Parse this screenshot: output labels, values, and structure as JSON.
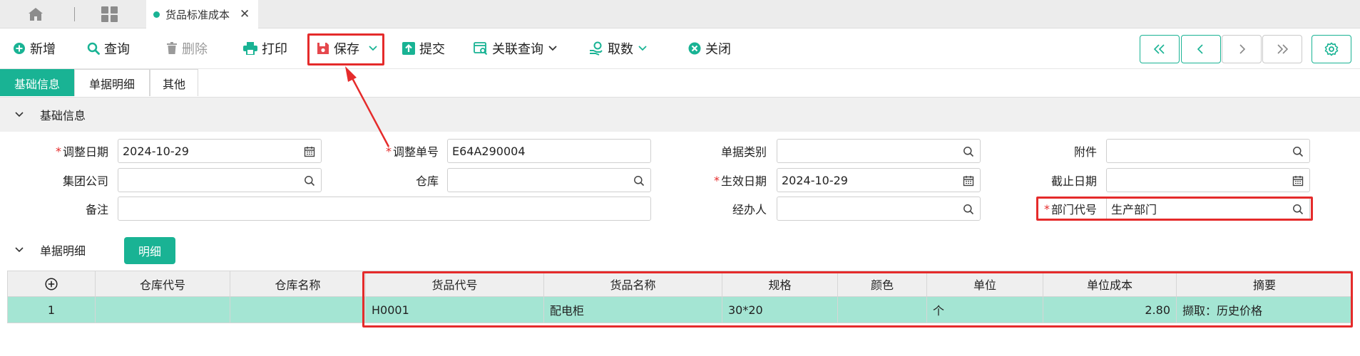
{
  "tabbar": {
    "active_tab_label": "货品标准成本",
    "close_glyph": "✕"
  },
  "toolbar": {
    "add": "新增",
    "query": "查询",
    "delete": "删除",
    "print": "打印",
    "save": "保存",
    "submit": "提交",
    "related_query": "关联查询",
    "fetch": "取数",
    "close": "关闭"
  },
  "subtabs": [
    "基础信息",
    "单据明细",
    "其他"
  ],
  "basic_section": {
    "title": "基础信息"
  },
  "form": {
    "adjust_date": {
      "label": "调整日期",
      "value": "2024-10-29",
      "required": true
    },
    "adjust_no": {
      "label": "调整单号",
      "value": "E64A290004",
      "required": true
    },
    "doc_type": {
      "label": "单据类别",
      "value": ""
    },
    "attachment": {
      "label": "附件",
      "value": ""
    },
    "group_company": {
      "label": "集团公司",
      "value": ""
    },
    "warehouse": {
      "label": "仓库",
      "value": ""
    },
    "effective_date": {
      "label": "生效日期",
      "value": "2024-10-29",
      "required": true
    },
    "end_date": {
      "label": "截止日期",
      "value": ""
    },
    "remark": {
      "label": "备注",
      "value": ""
    },
    "handler": {
      "label": "经办人",
      "value": ""
    },
    "dept_code": {
      "label": "部门代号",
      "value": "生产部门",
      "required": true
    },
    "required_mark": "*"
  },
  "detail_section": {
    "title": "单据明细",
    "button": "明细"
  },
  "table": {
    "headers": [
      "⊕",
      "仓库代号",
      "仓库名称",
      "货品代号",
      "货品名称",
      "规格",
      "颜色",
      "单位",
      "单位成本",
      "摘要"
    ],
    "rows": [
      [
        "1",
        "",
        "",
        "H0001",
        "配电柜",
        "30*20",
        "",
        "个",
        "2.80",
        "撷取：历史价格"
      ]
    ]
  },
  "colors": {
    "accent": "#19b394",
    "highlight_row": "#a4e5d3",
    "annotation_red": "#e52b2b"
  }
}
